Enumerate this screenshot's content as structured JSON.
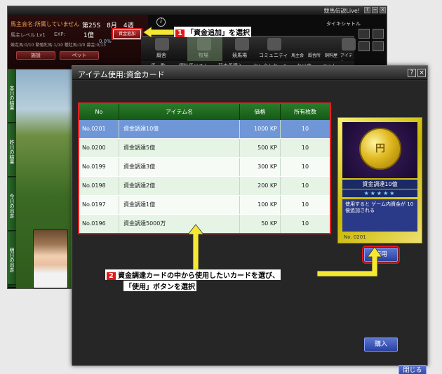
{
  "app": {
    "title": "競馬伝説Live!",
    "window_controls": [
      "?",
      "−",
      "×"
    ]
  },
  "status": {
    "owner_name": "馬主会名:所属していません",
    "owner_level": "馬主レベル:Lv1",
    "exp_label": "EXP:",
    "pct": "0.0%",
    "counts_line": "競走馬:0/10 繁殖牝馬:1/10 種牡馬:0/0 募金:0/13",
    "facility_button": "施設",
    "pet_button": "ペット",
    "week": "第25S　8月　4週",
    "money": "1億",
    "add_money_button": "資金追加",
    "owner_id": "タイキシャトル"
  },
  "nav": {
    "items": [
      "厩舎",
      "牧場",
      "競馬場",
      "コミュニティ",
      "馬主会",
      "厩舎所",
      "飼料屋",
      "アイテム"
    ],
    "sub_items": [
      "馬一覧",
      "種牡馬リスト",
      "競走馬購入",
      "セレクトセール",
      "セリ市",
      "ペット"
    ]
  },
  "left_tabs": [
    "本日の結果",
    "昨日の結果",
    "今日の出走",
    "明日の出走"
  ],
  "dialog": {
    "title": "アイテム使用:資金カード",
    "help_button": "?",
    "close_x": "×",
    "table": {
      "headers": [
        "No",
        "アイテム名",
        "価格",
        "所有枚数"
      ],
      "rows": [
        {
          "no": "No.0201",
          "name": "資金調達10億",
          "price": "1000 KP",
          "count": "10"
        },
        {
          "no": "No.0200",
          "name": "資金調達5億",
          "price": "500 KP",
          "count": "10"
        },
        {
          "no": "No.0199",
          "name": "資金調達3億",
          "price": "300 KP",
          "count": "10"
        },
        {
          "no": "No.0198",
          "name": "資金調達2億",
          "price": "200 KP",
          "count": "10"
        },
        {
          "no": "No.0197",
          "name": "資金調達1億",
          "price": "100 KP",
          "count": "10"
        },
        {
          "no": "No.0196",
          "name": "資金調達5000万",
          "price": "50 KP",
          "count": "10"
        }
      ]
    },
    "card": {
      "coin_glyph": "円",
      "name": "資金調達10億",
      "stars": "★★★★★",
      "description": "使用すると ゲーム内資金が 10億追加される",
      "number": "No. 0201"
    },
    "use_button": "使用",
    "buy_button": "購入",
    "close_button": "閉じる"
  },
  "annotations": {
    "step1_number": "1",
    "step1_text": "「資金追加」を選択",
    "step2_number": "2",
    "step2_line1": "資金調達カードの中から使用したいカードを選び、",
    "step2_line2": "「使用」ボタンを選択"
  },
  "colors": {
    "highlight_red": "#e01818",
    "table_header_green": "#155a15",
    "selected_row_blue": "#6f96d6",
    "button_blue": "#2a40a0"
  }
}
